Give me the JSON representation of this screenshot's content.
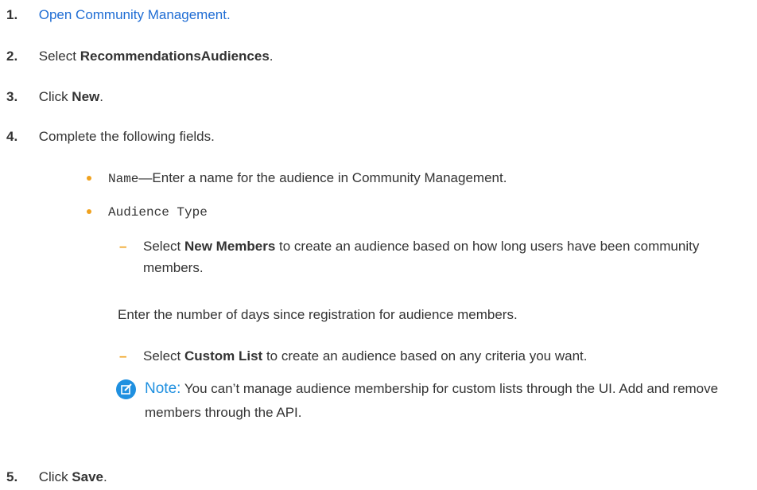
{
  "steps": [
    {
      "num": "1.",
      "link": "Open Community Management."
    },
    {
      "num": "2.",
      "prefix": "Select ",
      "bold": "RecommendationsAudiences",
      "suffix": "."
    },
    {
      "num": "3.",
      "prefix": "Click ",
      "bold": "New",
      "suffix": "."
    },
    {
      "num": "4.",
      "text": "Complete the following fields."
    },
    {
      "num": "5.",
      "prefix": "Click ",
      "bold": "Save",
      "suffix": "."
    }
  ],
  "fields": {
    "name_code": "Name",
    "name_desc": "—Enter a name for the audience in Community Management.",
    "audience_code": "Audience Type"
  },
  "options": [
    {
      "dash": "–",
      "prefix": "Select ",
      "bold": "New Members",
      "suffix": " to create an audience based on how long users have been community members.",
      "followup": "Enter the number of days since registration for audience members."
    },
    {
      "dash": "–",
      "prefix": "Select ",
      "bold": "Custom List",
      "suffix": " to create an audience based on any criteria you want."
    }
  ],
  "note": {
    "label": "Note:",
    "text": "You can’t manage audience membership for custom lists through the UI. Add and remove members through the API."
  },
  "colors": {
    "link": "#1f6dd4",
    "accent": "#f0a21f",
    "note_blue": "#1f90e0"
  }
}
